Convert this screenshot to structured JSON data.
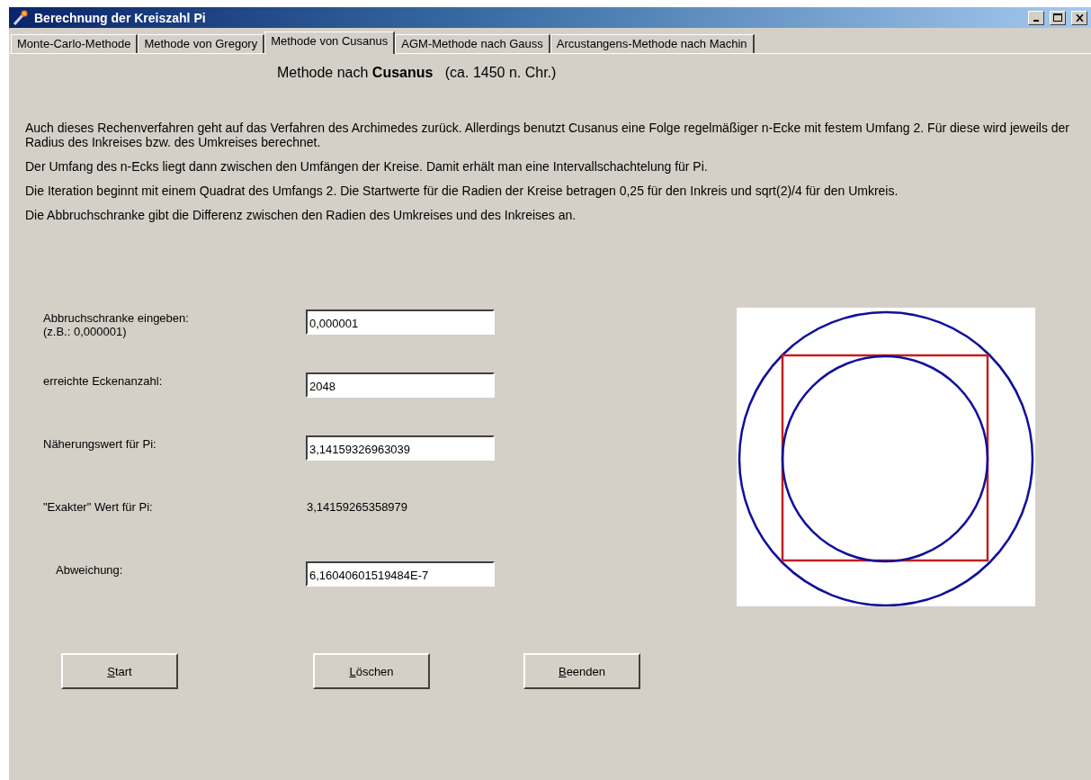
{
  "window": {
    "title": "Berechnung der Kreiszahl Pi"
  },
  "tabs": [
    {
      "label": "Monte-Carlo-Methode",
      "selected": false
    },
    {
      "label": "Methode von Gregory",
      "selected": false
    },
    {
      "label": "Methode von Cusanus",
      "selected": true
    },
    {
      "label": "AGM-Methode nach Gauss",
      "selected": false
    },
    {
      "label": "Arcustangens-Methode nach Machin",
      "selected": false
    }
  ],
  "heading": "Methode nach **Cusanus**   (ca. 1450 n. Chr.)",
  "paragraphs": [
    "Auch dieses Rechenverfahren geht auf das Verfahren des Archimedes zurück. Allerdings benutzt Cusanus eine Folge regelmäßiger n-Ecke mit festem Umfang 2. Für diese wird jeweils der Radius des Inkreises bzw. des Umkreises berechnet.",
    "Der Umfang des n-Ecks liegt dann zwischen den Umfängen der Kreise. Damit erhält man eine Intervallschachtelung für Pi.",
    "Die Iteration beginnt mit einem Quadrat des Umfangs 2. Die Startwerte für die Radien der Kreise betragen 0,25 für den Inkreis und sqrt(2)/4 für den Umkreis.",
    "Die Abbruchschranke gibt die Differenz zwischen den Radien des Umkreises und des Inkreises an."
  ],
  "fields": [
    {
      "kind": "input",
      "label": "Abbruchschranke eingeben:",
      "hint": "(z.B.: 0,000001)",
      "value": "0,000001"
    },
    {
      "kind": "input",
      "label": "erreichte Eckenanzahl:",
      "value": "2048"
    },
    {
      "kind": "input",
      "label": "Näherungswert für Pi:",
      "value": "3,14159326963039"
    },
    {
      "kind": "static",
      "label": "\"Exakter\" Wert für Pi:",
      "value": "3,14159265358979"
    },
    {
      "kind": "input",
      "label": "Abweichung:",
      "value": "6,16040601519484E-7",
      "indent": true
    }
  ],
  "buttons": [
    "Start",
    "Löschen",
    "Beenden"
  ]
}
